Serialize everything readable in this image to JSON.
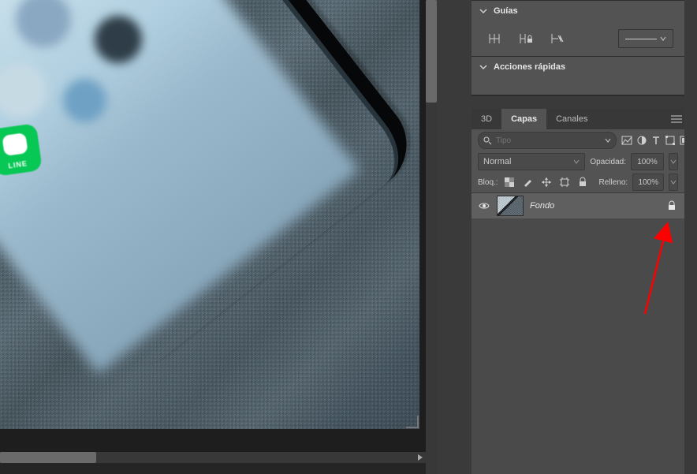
{
  "line_app_label": "LINE",
  "properties": {
    "guides": {
      "title": "Guías"
    },
    "quick_actions": {
      "title": "Acciones rápidas"
    }
  },
  "layers_panel": {
    "tabs": {
      "t3d": "3D",
      "layers": "Capas",
      "channels": "Canales"
    },
    "type_filter_placeholder": "Tipo",
    "blend_mode": "Normal",
    "opacity_label": "Opacidad:",
    "opacity_value": "100%",
    "lock_label": "Bloq.:",
    "fill_label": "Relleno:",
    "fill_value": "100%",
    "layers": [
      {
        "name": "Fondo",
        "locked": true,
        "visible": true
      }
    ]
  }
}
